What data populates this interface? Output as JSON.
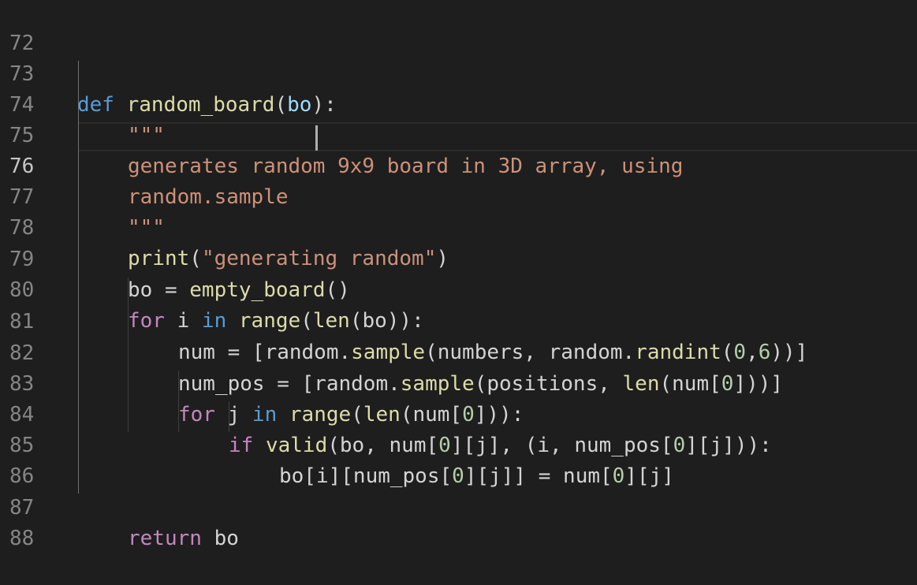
{
  "editor": {
    "line_numbers": [
      "72",
      "73",
      "74",
      "75",
      "76",
      "77",
      "78",
      "79",
      "80",
      "81",
      "82",
      "83",
      "84",
      "85",
      "86",
      "87",
      "88"
    ],
    "active_line": "76",
    "code": {
      "l73": {
        "def": "def",
        "space": " ",
        "fname": "random_board",
        "open": "(",
        "param": "bo",
        "close": "):"
      },
      "l74": {
        "doc": "\"\"\""
      },
      "l75": {
        "doc": "generates random 9x9 board in 3D array, using"
      },
      "l76": {
        "doc": "random.sample "
      },
      "l77": {
        "doc": "\"\"\""
      },
      "l78": {
        "fn": "print",
        "open": "(",
        "str": "\"generating random\"",
        "close": ")"
      },
      "l79": {
        "a": "bo = ",
        "fn": "empty_board",
        "b": "()"
      },
      "l80": {
        "for": "for",
        "a": " i ",
        "in": "in",
        "sp": " ",
        "range": "range",
        "p1": "(",
        "len": "len",
        "p2": "(bo)):"
      },
      "l81": {
        "a": "num = [random.",
        "sample": "sample",
        "b": "(numbers, random.",
        "randint": "randint",
        "c": "(",
        "n0": "0",
        "comma": ",",
        "n6": "6",
        "d": "))]"
      },
      "l82": {
        "a": "num_pos = [random.",
        "sample": "sample",
        "b": "(positions, ",
        "len": "len",
        "c": "(num[",
        "n0": "0",
        "d": "]))]"
      },
      "l83": {
        "for": "for",
        "a": " j ",
        "in": "in",
        "sp": " ",
        "range": "range",
        "p1": "(",
        "len": "len",
        "b": "(num[",
        "n0": "0",
        "c": "])):"
      },
      "l84": {
        "if": "if",
        "sp": " ",
        "valid": "valid",
        "a": "(bo, num[",
        "n0a": "0",
        "b": "][j], (i, num_pos[",
        "n0b": "0",
        "c": "][j])):"
      },
      "l85": {
        "a": "bo[i][num_pos[",
        "n0a": "0",
        "b": "][j]] = num[",
        "n0b": "0",
        "c": "][j]"
      },
      "l87": {
        "ret": "return",
        "a": " bo"
      }
    },
    "colors": {
      "background": "#1e1e1e",
      "keyword": "#569cd6",
      "control": "#c586c0",
      "function": "#dcdcaa",
      "parameter": "#9cdcfe",
      "string": "#ce9178",
      "number": "#b5cea8",
      "line_number": "#858585"
    }
  }
}
